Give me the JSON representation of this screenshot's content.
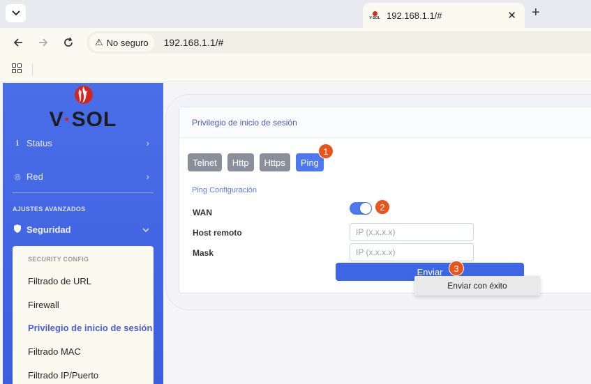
{
  "browser": {
    "tab_title": "192.168.1.1/#",
    "favicon_text": "V·SOL",
    "security_label": "No seguro",
    "url": "192.168.1.1/#"
  },
  "sidebar": {
    "logo_v": "V",
    "logo_dot": "·",
    "logo_sol": "SOL",
    "nav_items": [
      {
        "label": "Status"
      },
      {
        "label": "Red"
      }
    ],
    "section_title": "AJUSTES AVANZADOS",
    "security_item": {
      "label": "Seguridad"
    },
    "submenu": {
      "heading": "SECURITY CONFIG",
      "items": [
        {
          "label": "Filtrado de URL"
        },
        {
          "label": "Firewall"
        },
        {
          "label": "Privilegio de inicio de sesión"
        },
        {
          "label": "Filtrado MAC"
        },
        {
          "label": "Filtrado IP/Puerto"
        }
      ]
    }
  },
  "main": {
    "card_title": "Privilegio de inicio de sesión",
    "tabs": [
      {
        "label": "Telnet"
      },
      {
        "label": "Http"
      },
      {
        "label": "Https"
      },
      {
        "label": "Ping"
      }
    ],
    "active_tab": "Ping",
    "section_title": "Ping Configuración",
    "form": {
      "wan_label": "WAN",
      "wan_enabled": true,
      "host_label": "Host remoto",
      "host_placeholder": "IP (x.x.x.x)",
      "host_value": "",
      "mask_label": "Mask",
      "mask_placeholder": "IP (x.x.x.x)",
      "mask_value": ""
    },
    "submit_label": "Enviar",
    "toast_message": "Enviar con éxito"
  },
  "annotations": [
    "1",
    "2",
    "3"
  ],
  "colors": {
    "sidebar": "#4a6ee8",
    "accent": "#4d78f0",
    "badge": "#e8541a",
    "logo_red": "#d0261f"
  }
}
